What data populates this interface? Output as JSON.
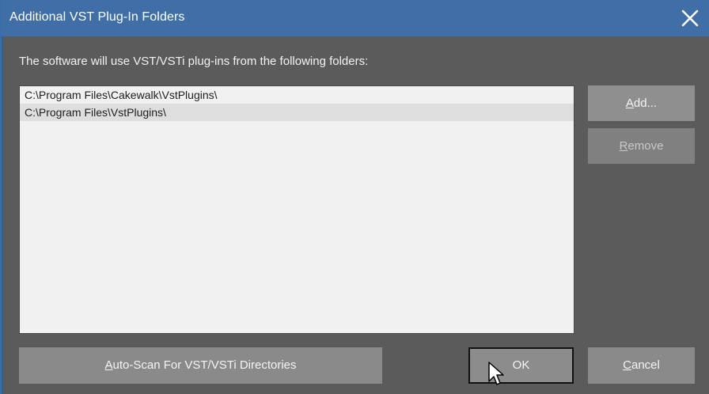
{
  "window": {
    "title": "Additional VST Plug-In Folders"
  },
  "description": "The software will use VST/VSTi plug-ins from the following folders:",
  "folders": [
    "C:\\Program Files\\Cakewalk\\VstPlugins\\",
    "C:\\Program Files\\VstPlugins\\"
  ],
  "buttons": {
    "add": {
      "mnemonic": "A",
      "rest": "dd..."
    },
    "remove": {
      "mnemonic": "R",
      "rest": "emove"
    },
    "autoscan": {
      "pre": "",
      "mnemonic": "A",
      "rest": "uto-Scan For VST/VSTi Directories"
    },
    "ok": "OK",
    "cancel": {
      "mnemonic": "C",
      "rest": "ancel"
    }
  },
  "colors": {
    "titlebar": "#3f6fa6",
    "background": "#5b5b5b",
    "list_bg": "#f1f1f1",
    "button_bg": "#8a8a8a"
  },
  "icons": {
    "close": "close-icon",
    "cursor": "mouse-pointer-icon"
  }
}
